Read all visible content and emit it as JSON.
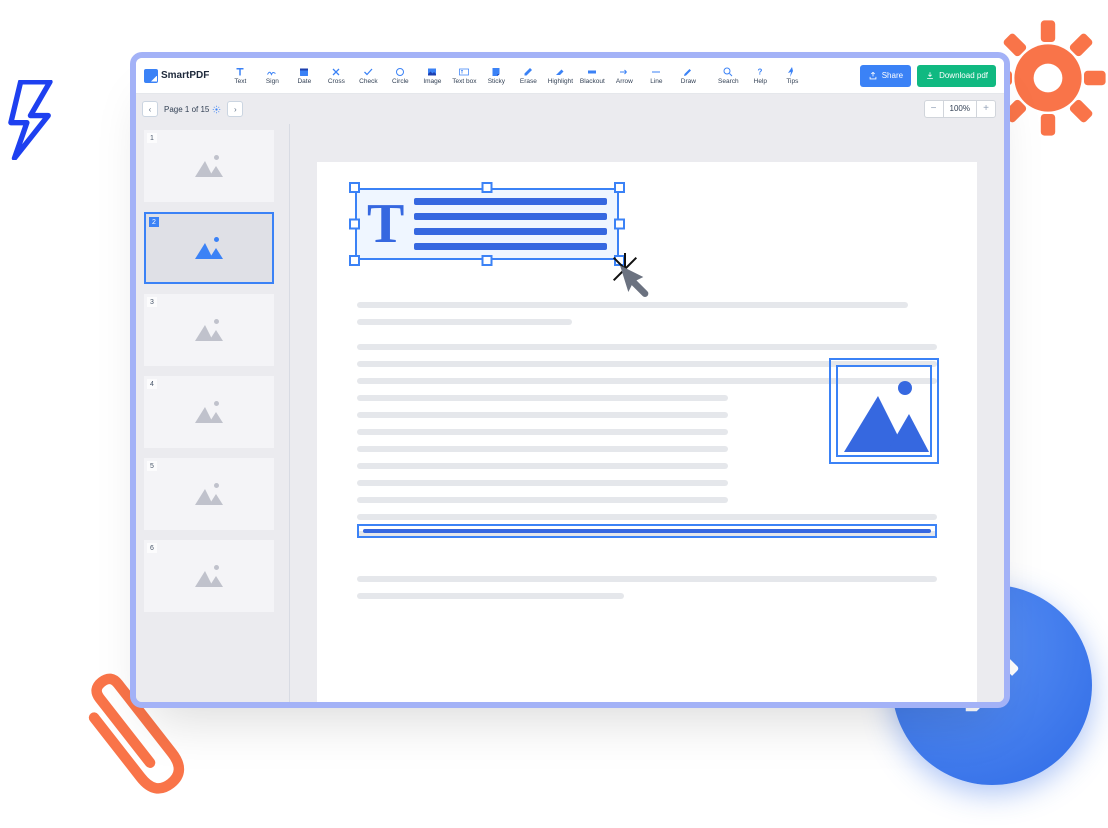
{
  "brand": {
    "name": "SmartPDF"
  },
  "toolbar": {
    "text": "Text",
    "sign": "Sign",
    "date": "Date",
    "cross": "Cross",
    "check": "Check",
    "circle": "Circle",
    "image": "Image",
    "textbox": "Text box",
    "sticky": "Sticky",
    "erase": "Erase",
    "highlight": "Highlight",
    "blackout": "Blackout",
    "arrow": "Arrow",
    "line": "Line",
    "draw": "Draw",
    "search": "Search",
    "help": "Help",
    "tips": "Tips",
    "share": "Share",
    "download": "Download pdf"
  },
  "pagenav": {
    "label": "Page 1 of 15",
    "current": 1,
    "total": 15
  },
  "zoom": {
    "value": "100%"
  },
  "thumbnails": [
    {
      "page": "1",
      "selected": false
    },
    {
      "page": "2",
      "selected": true
    },
    {
      "page": "3",
      "selected": false
    },
    {
      "page": "4",
      "selected": false
    },
    {
      "page": "5",
      "selected": false
    },
    {
      "page": "6",
      "selected": false
    }
  ],
  "colors": {
    "accent": "#3b82f6",
    "success": "#10b981",
    "decor_orange": "#f97316"
  }
}
